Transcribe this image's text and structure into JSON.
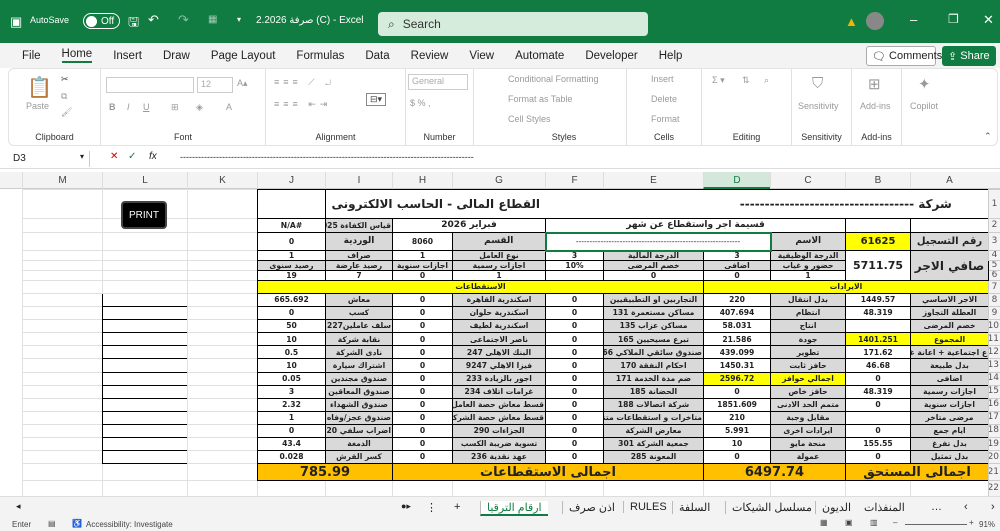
{
  "titlebar": {
    "autosave": "AutoSave",
    "autosave_state": "Off",
    "doc_title": "2.2026 صرفة (C)  -  Excel",
    "search_placeholder": "Search"
  },
  "menu": {
    "items": [
      "File",
      "Home",
      "Insert",
      "Draw",
      "Page Layout",
      "Formulas",
      "Data",
      "Review",
      "View",
      "Automate",
      "Developer",
      "Help"
    ],
    "comments": "Comments",
    "share": "Share"
  },
  "ribbon": {
    "clipboard": {
      "paste": "Paste",
      "label": "Clipboard"
    },
    "font": {
      "name": "",
      "size": "12",
      "label": "Font"
    },
    "alignment": {
      "label": "Alignment"
    },
    "number": {
      "format": "General",
      "label": "Number"
    },
    "styles": {
      "conditional": "Conditional Formatting",
      "table": "Format as Table",
      "cell": "Cell Styles",
      "label": "Styles"
    },
    "cells": {
      "insert": "Insert",
      "delete": "Delete",
      "format": "Format",
      "label": "Cells"
    },
    "editing": {
      "label": "Editing"
    },
    "sensitivity": {
      "button": "Sensitivity",
      "label": "Sensitivity"
    },
    "addins": {
      "button": "Add-ins",
      "label": "Add-ins"
    },
    "copilot": {
      "button": "Copilot"
    }
  },
  "formula_bar": {
    "name_box": "D3",
    "fx": "fx",
    "content": "--------------------------------------------------------------------------------------------------"
  },
  "columns": [
    "M",
    "L",
    "K",
    "J",
    "I",
    "H",
    "G",
    "F",
    "E",
    "D",
    "C",
    "B",
    "A"
  ],
  "sheet": {
    "r1": {
      "company": "شركة -----------------------------------",
      "sector": "القطاع المالى - الحاسب الالكترونى"
    },
    "r2": {
      "slip": "قسيمة اجر  واستقطاع عن شهر",
      "month": "فبراير 2026",
      "kpi_label": "قياس الكفاءة 2025",
      "kpi_value": "#N/A"
    },
    "r3": {
      "reg_label": "رقم التسجيل",
      "reg_value": "61625",
      "name_label": "الاسم",
      "name_value": "------------------------------------------------------------",
      "dept_label": "القسم",
      "dept_value": "8060",
      "shift_label": "الوردية",
      "shift_value": "0"
    },
    "net": {
      "label": "صافي الاجر",
      "value": "5711.75"
    },
    "r4": [
      "الدرجة الوظيفية",
      "3",
      "الدرجة المالية",
      "3",
      "نوع العامل",
      "1",
      "صراف",
      "1"
    ],
    "r5": [
      "حضور و غياب",
      "اضافى",
      "خصم المرضى",
      "10%",
      "اجازات رسمية",
      "اجازات سنوية",
      "رصيد عارضة",
      "رصيد سنوى"
    ],
    "r6": [
      "1",
      "0",
      "0",
      "",
      "1",
      "0",
      "7",
      "19"
    ],
    "r7": {
      "income": "الايرادات",
      "deductions": "الاستقطاعات"
    },
    "rows": [
      [
        "الاجر الاساسي",
        "1449.57",
        "بدل انتقال",
        "220",
        "التجاربين او التطبيقيين",
        "0",
        "اسكندرية القاهرة",
        "0",
        "معاش",
        "665.692"
      ],
      [
        "العطلة التجاوز",
        "48.319",
        "انتظام",
        "407.694",
        "مساكن مستعمرة 131",
        "0",
        "اسكندرية حلوان",
        "0",
        "كسب",
        "0"
      ],
      [
        "خصم المرضى",
        "",
        "انتاج",
        "58.031",
        "مساكن عزاب 135",
        "0",
        "اسكندرية لطيف",
        "0",
        "سلف عاملين227",
        "50"
      ],
      [
        "المجموع",
        "1401.251",
        "جودة",
        "21.586",
        "تبرع مسيحيين 165",
        "0",
        "ناصر الاجتماعى",
        "0",
        "نقابة شركة",
        "10"
      ],
      [
        "ع اجتماعية + اعانة غلاء",
        "171.62",
        "تطوير",
        "439.099",
        "صندوق سائقي الملاكي 166",
        "0",
        "البنك الاهلى 247",
        "0",
        "نادى الشركة",
        "0.5"
      ],
      [
        "بدل طبيعة",
        "46.68",
        "حافز ثابت",
        "1450.31",
        "احكام النفقة 170",
        "0",
        "فيزا الاهلي 9247",
        "0",
        "اشتراك سيارة",
        "10"
      ],
      [
        "اضافى",
        "0",
        "اجمالي حوافز",
        "2596.72",
        "ضم مدة الخدمة 171",
        "0",
        "اجور بالزيادة 233",
        "0",
        "صندوق مجندين",
        "0.05"
      ],
      [
        "اجازات رسمية",
        "48.319",
        "حافز خاص",
        "0",
        "الحضانة 185",
        "0",
        "غرامات اتلاف 234",
        "0",
        "صندوق المعاقين",
        "3"
      ],
      [
        "اجازات سنوية",
        "0",
        "متمم الحد الادنى",
        "1851.609",
        "شركة اتصالات 188",
        "0",
        "قسط معاش حصة العامل",
        "0",
        "صندوق الشهداء",
        "2.32"
      ],
      [
        "مرضى متاخر",
        "",
        "مقابل وجبة",
        "210",
        "متاخرات و استقطاعات متنوعة",
        "0",
        "قسط معاش حصة الشركة",
        "0",
        "صندوق عجز/وفاه",
        "1"
      ],
      [
        "ايام جمع",
        "0",
        "ايرادات اخرى",
        "5.991",
        "معارض الشركة",
        "0",
        "الجزاءات 290",
        "0",
        "اضراب سلفي 120",
        "0"
      ],
      [
        "بدل تفرغ",
        "155.55",
        "منحة مايو",
        "10",
        "جمعية الشركة 301",
        "0",
        "تسوية ضريبة الكسب",
        "0",
        "الدمغة",
        "43.4"
      ],
      [
        "بدل تمثيل",
        "0",
        "عمولة",
        "0",
        "المعونة 285",
        "0",
        "عهد نقدية 236",
        "0",
        "كسر القرش",
        "0.028"
      ]
    ],
    "r21": {
      "gross_label": "اجمالى المستحق",
      "gross_value": "6497.74",
      "ded_label": "اجمالى الاستقطاعات",
      "ded_value": "785.99"
    },
    "print_button": "PRINT"
  },
  "tabs": [
    "المنفذات",
    "الديون",
    "مسلسل الشيكات",
    "السلفة",
    "RULES",
    "اذن صرف",
    "ارقام الترقيا"
  ],
  "status": {
    "mode": "Enter",
    "accessibility": "Accessibility: Investigate",
    "zoom": "91%"
  },
  "colors": {
    "excel_green": "#107c41",
    "yellow": "#ffff00",
    "total_orange": "#ffc000",
    "header_gray": "#d9d9d9"
  }
}
